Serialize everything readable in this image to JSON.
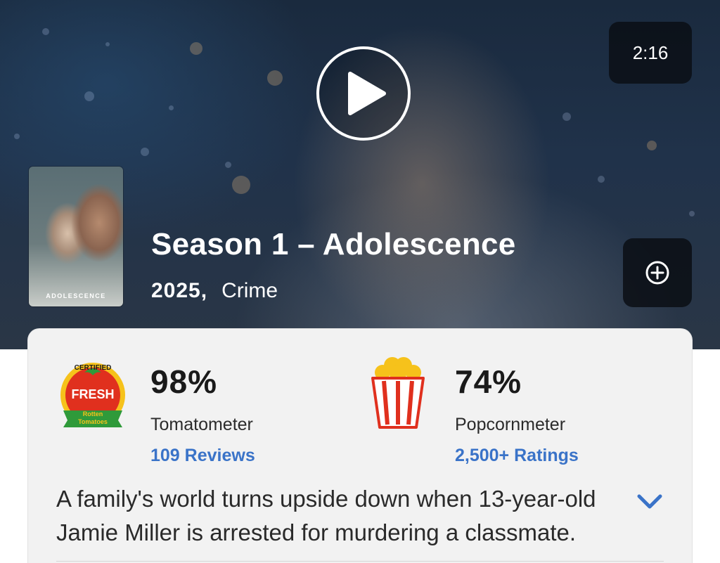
{
  "video": {
    "duration": "2:16"
  },
  "poster": {
    "title_text": "ADOLESCENCE"
  },
  "show": {
    "title": "Season 1 – Adolescence",
    "year": "2025,",
    "genre": "Crime"
  },
  "scores": {
    "tomatometer": {
      "badge": "Certified Fresh",
      "value": "98%",
      "label": "Tomatometer",
      "link": "109 Reviews"
    },
    "popcornmeter": {
      "value": "74%",
      "label": "Popcornmeter",
      "link": "2,500+ Ratings"
    }
  },
  "synopsis": "A family's world turns upside down when 13-year-old Jamie Miller is arrested for murdering a classmate.",
  "colors": {
    "link_blue": "#3a73c8",
    "fresh_red": "#e0301e",
    "card_bg": "#f2f2f2"
  },
  "icons": {
    "play": "play-icon",
    "add": "plus-circle-icon",
    "expand": "chevron-down-icon"
  }
}
